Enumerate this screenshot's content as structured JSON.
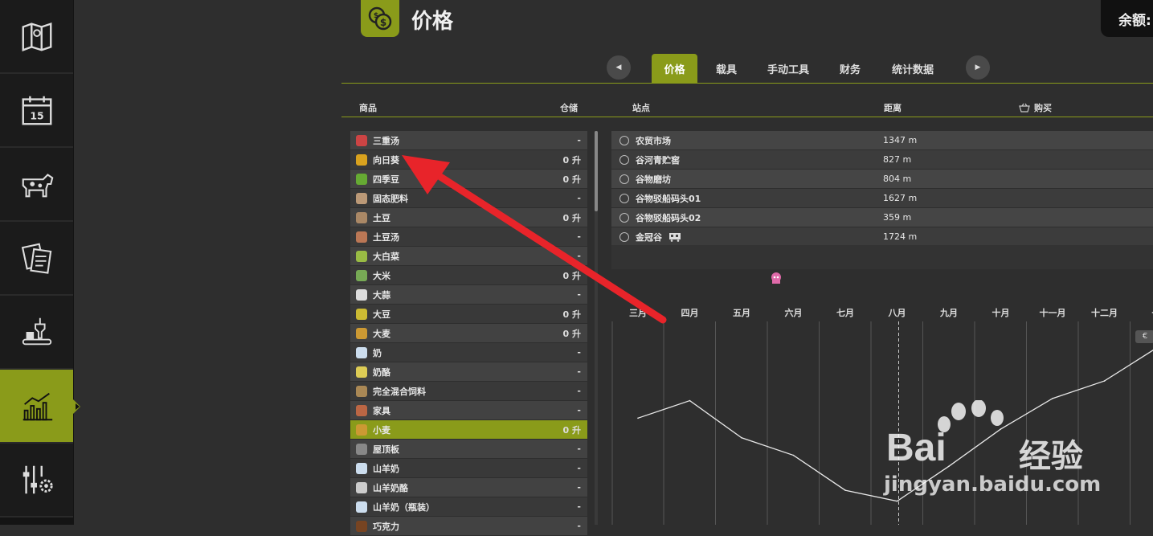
{
  "header": {
    "title": "价格",
    "balance_label": "余额:"
  },
  "tabs": [
    {
      "label": "价格",
      "active": true
    },
    {
      "label": "载具",
      "active": false
    },
    {
      "label": "手动工具",
      "active": false
    },
    {
      "label": "财务",
      "active": false
    },
    {
      "label": "统计数据",
      "active": false
    }
  ],
  "nav": {
    "prev": "◀",
    "next": "▶"
  },
  "columns": {
    "goods": "商品",
    "storage": "仓储",
    "station": "站点",
    "distance": "距离",
    "buy": "购买"
  },
  "goods": [
    {
      "name": "三重汤",
      "qty": "-",
      "icon": "soup-can-icon",
      "color": "#c44"
    },
    {
      "name": "向日葵",
      "qty": "0 升",
      "icon": "sunflower-icon",
      "color": "#d9a21e"
    },
    {
      "name": "四季豆",
      "qty": "0 升",
      "icon": "green-bean-icon",
      "color": "#6a3"
    },
    {
      "name": "固态肥料",
      "qty": "-",
      "icon": "fertilizer-bag-icon",
      "color": "#b97"
    },
    {
      "name": "土豆",
      "qty": "0 升",
      "icon": "potato-icon",
      "color": "#a86"
    },
    {
      "name": "土豆汤",
      "qty": "-",
      "icon": "soup-can-icon",
      "color": "#b75"
    },
    {
      "name": "大白菜",
      "qty": "-",
      "icon": "cabbage-icon",
      "color": "#9b4"
    },
    {
      "name": "大米",
      "qty": "0 升",
      "icon": "rice-icon",
      "color": "#7a5"
    },
    {
      "name": "大蒜",
      "qty": "-",
      "icon": "garlic-icon",
      "color": "#ddd"
    },
    {
      "name": "大豆",
      "qty": "0 升",
      "icon": "soybean-icon",
      "color": "#cb3"
    },
    {
      "name": "大麦",
      "qty": "0 升",
      "icon": "barley-icon",
      "color": "#c93"
    },
    {
      "name": "奶",
      "qty": "-",
      "icon": "milk-bottle-icon",
      "color": "#cde"
    },
    {
      "name": "奶酪",
      "qty": "-",
      "icon": "cheese-icon",
      "color": "#dc5"
    },
    {
      "name": "完全混合饲料",
      "qty": "-",
      "icon": "feed-mix-icon",
      "color": "#a85"
    },
    {
      "name": "家具",
      "qty": "-",
      "icon": "furniture-icon",
      "color": "#b64"
    },
    {
      "name": "小麦",
      "qty": "0 升",
      "icon": "wheat-icon",
      "color": "#c93",
      "active": true
    },
    {
      "name": "屋顶板",
      "qty": "-",
      "icon": "roof-panel-icon",
      "color": "#888"
    },
    {
      "name": "山羊奶",
      "qty": "-",
      "icon": "milk-bottle-icon",
      "color": "#cde"
    },
    {
      "name": "山羊奶酪",
      "qty": "-",
      "icon": "cheese-icon",
      "color": "#ccc"
    },
    {
      "name": "山羊奶（瓶装）",
      "qty": "-",
      "icon": "milk-bottle-icon",
      "color": "#cde"
    },
    {
      "name": "巧克力",
      "qty": "-",
      "icon": "chocolate-icon",
      "color": "#742"
    }
  ],
  "stations": [
    {
      "name": "农贸市场",
      "distance": "1347 m"
    },
    {
      "name": "谷河青贮窖",
      "distance": "827 m"
    },
    {
      "name": "谷物磨坊",
      "distance": "804 m"
    },
    {
      "name": "谷物驳船码头01",
      "distance": "1627 m"
    },
    {
      "name": "谷物驳船码头02",
      "distance": "359 m"
    },
    {
      "name": "金冠谷",
      "distance": "1724 m"
    }
  ],
  "chart_data": {
    "type": "line",
    "categories": [
      "三月",
      "四月",
      "五月",
      "六月",
      "七月",
      "八月",
      "九月",
      "十月",
      "十一月",
      "十二月",
      "一"
    ],
    "series": [
      {
        "values": [
          0.44,
          0.52,
          0.35,
          0.27,
          0.11,
          0.06,
          0.22,
          0.39,
          0.53,
          0.61,
          0.76
        ]
      }
    ],
    "ylim": [
      0,
      1
    ],
    "current_month": "八月",
    "currency_badge": "€",
    "grid": true
  },
  "watermark": {
    "logo": "Bai",
    "logo2": "经验",
    "url": "jingyan.baidu.com"
  }
}
